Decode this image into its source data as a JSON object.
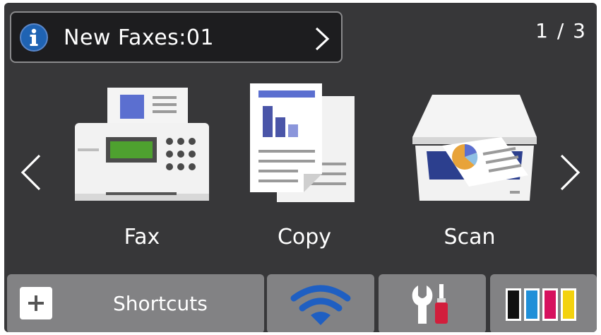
{
  "notification": {
    "label": "New Faxes:01",
    "info_icon": "info-icon",
    "chevron_icon": "chevron-right-icon"
  },
  "pager": {
    "label": "1 / 3"
  },
  "carousel": {
    "prev_icon": "chevron-left-icon",
    "next_icon": "chevron-right-icon"
  },
  "functions": [
    {
      "label": "Fax",
      "icon": "fax-machine-icon"
    },
    {
      "label": "Copy",
      "icon": "copy-documents-icon"
    },
    {
      "label": "Scan",
      "icon": "scanner-icon"
    }
  ],
  "bottom_bar": {
    "shortcuts": {
      "label": "Shortcuts",
      "icon": "plus-icon"
    },
    "wifi": {
      "icon": "wifi-icon"
    },
    "tools": {
      "icon": "wrench-screwdriver-icon"
    },
    "ink": {
      "icon": "ink-cartridges-icon",
      "colors": [
        "#111111",
        "#1f8fd8",
        "#d6125e",
        "#f3d20e"
      ]
    }
  },
  "colors": {
    "screen_bg": "#373739",
    "button_bg": "#828284",
    "info_blue": "#1f63b3",
    "wifi_blue": "#1f5fc2"
  }
}
